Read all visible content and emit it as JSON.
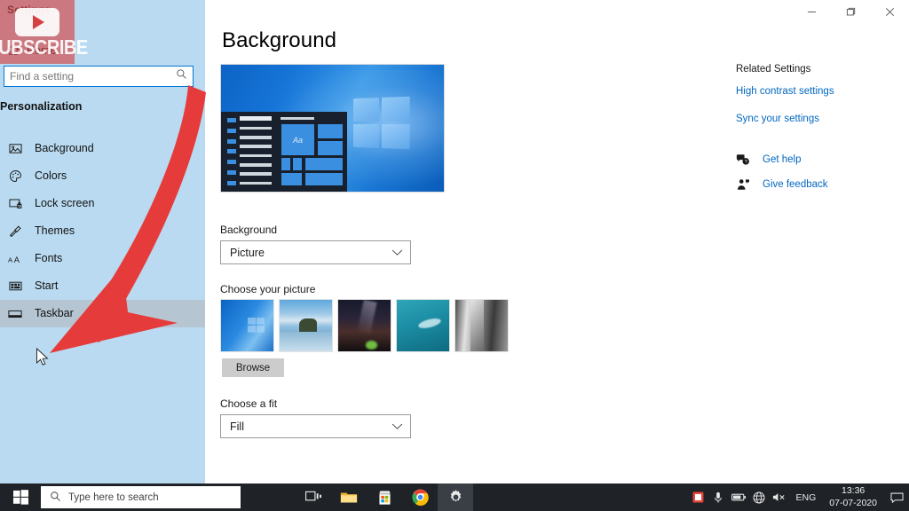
{
  "window": {
    "app_title": "Settings",
    "controls": {
      "minimize": "Minimize",
      "restore": "Restore",
      "close": "Close"
    }
  },
  "sidebar": {
    "home_label": "Home",
    "search": {
      "value": "",
      "placeholder": "Find a setting",
      "icon": "search-icon"
    },
    "category": "Personalization",
    "items": [
      {
        "label": "Background",
        "icon": "picture-icon",
        "active": false
      },
      {
        "label": "Colors",
        "icon": "palette-icon",
        "active": false
      },
      {
        "label": "Lock screen",
        "icon": "lock-screen-icon",
        "active": false
      },
      {
        "label": "Themes",
        "icon": "brush-icon",
        "active": false
      },
      {
        "label": "Fonts",
        "icon": "fonts-aa-icon",
        "active": false
      },
      {
        "label": "Start",
        "icon": "start-tiles-icon",
        "active": false
      },
      {
        "label": "Taskbar",
        "icon": "taskbar-icon",
        "active": true
      }
    ]
  },
  "main": {
    "page_title": "Background",
    "preview": {
      "tile_text": "Aa"
    },
    "background_label": "Background",
    "background_value": "Picture",
    "choose_picture_label": "Choose your picture",
    "thumbnails": [
      "windows-blue-logo-wallpaper",
      "beach-sea-stack-wallpaper",
      "milky-way-night-wallpaper",
      "underwater-teal-wallpaper",
      "rock-cliff-bw-wallpaper"
    ],
    "browse_label": "Browse",
    "fit_label": "Choose a fit",
    "fit_value": "Fill"
  },
  "related": {
    "heading": "Related Settings",
    "links": [
      "High contrast settings",
      "Sync your settings"
    ],
    "help_rows": [
      {
        "label": "Get help",
        "icon": "get-help-icon"
      },
      {
        "label": "Give feedback",
        "icon": "give-feedback-icon"
      }
    ]
  },
  "overlay": {
    "subscribe_text": "SUBSCRIBE",
    "play_icon": "youtube-play-icon",
    "arrow": "red-arrow-pointing-to-taskbar",
    "cursor": "mouse-pointer"
  },
  "taskbar": {
    "start_icon": "windows-start-icon",
    "search_placeholder": "Type here to search",
    "search_icon": "search-icon",
    "buttons": [
      {
        "name": "task-view",
        "icon": "task-view-icon",
        "active": false
      },
      {
        "name": "file-explorer",
        "icon": "file-explorer-icon",
        "active": false
      },
      {
        "name": "microsoft-store",
        "icon": "microsoft-store-icon",
        "active": false
      },
      {
        "name": "google-chrome",
        "icon": "chrome-icon",
        "active": false
      },
      {
        "name": "settings",
        "icon": "gear-icon",
        "active": true
      }
    ],
    "tray": [
      {
        "name": "tray-app-red",
        "icon": "red-square-icon"
      },
      {
        "name": "tray-microphone",
        "icon": "microphone-icon"
      },
      {
        "name": "tray-battery",
        "icon": "battery-icon"
      },
      {
        "name": "tray-network",
        "icon": "globe-icon"
      },
      {
        "name": "tray-volume",
        "icon": "speaker-muted-icon"
      }
    ],
    "language": "ENG",
    "time": "13:36",
    "date": "07-07-2020",
    "action_center_icon": "action-center-icon"
  },
  "colors": {
    "sidebar_bg": "#b9daf0",
    "accent_link": "#0067c0",
    "taskbar_bg": "#1f2227",
    "arrow_red": "#e63b3b",
    "active_row": "#b6c5d2"
  }
}
